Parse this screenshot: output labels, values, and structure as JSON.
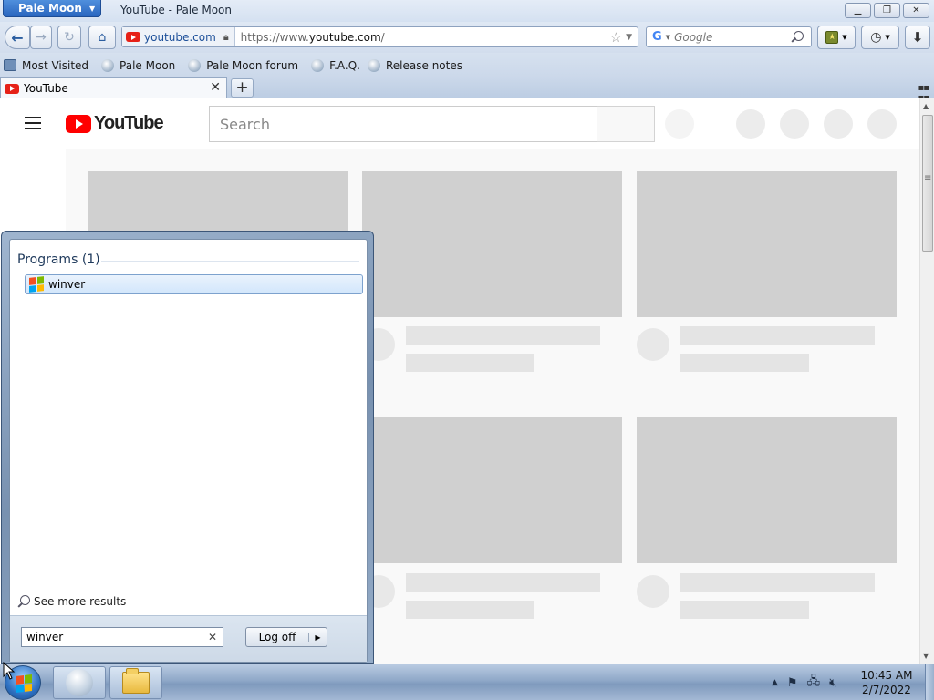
{
  "browser": {
    "app_menu_label": "Pale Moon",
    "window_title": "YouTube - Pale Moon",
    "url_identity": "youtube.com",
    "url_prefix": "https://www.",
    "url_domain": "youtube.com",
    "url_suffix": "/",
    "search_engine_placeholder": "Google",
    "bookmarks": [
      {
        "label": "Most Visited"
      },
      {
        "label": "Pale Moon"
      },
      {
        "label": "Pale Moon forum"
      },
      {
        "label": "F.A.Q."
      },
      {
        "label": "Release notes"
      }
    ],
    "tab_title": "YouTube",
    "new_tab_label": "+"
  },
  "youtube": {
    "logo_text": "YouTube",
    "search_placeholder": "Search"
  },
  "start_menu": {
    "programs_heading": "Programs (1)",
    "result_label": "winver",
    "see_more_label": "See more results",
    "search_value": "winver",
    "logoff_label": "Log off"
  },
  "taskbar": {
    "time": "10:45 AM",
    "date": "2/7/2022"
  },
  "colors": {
    "youtube_red": "#ff0000",
    "start_selection": "#d2e6fb",
    "taskbar": "#8fa8c8"
  }
}
